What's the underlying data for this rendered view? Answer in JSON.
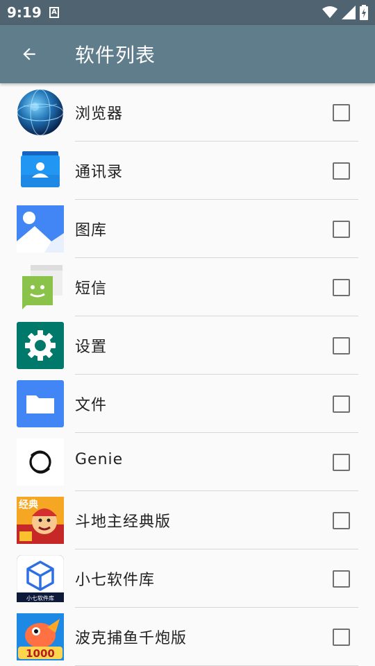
{
  "status_bar": {
    "time": "9:19",
    "notification_icon": "a-notification-icon",
    "icons": [
      "wifi-icon",
      "signal-icon",
      "battery-charging-icon"
    ]
  },
  "app_bar": {
    "title": "软件列表",
    "back_icon": "arrow-back-icon",
    "background": "#607d8b"
  },
  "apps": [
    {
      "label": "浏览器",
      "icon": "globe-icon",
      "checked": false
    },
    {
      "label": "通讯录",
      "icon": "contacts-icon",
      "checked": false
    },
    {
      "label": "图库",
      "icon": "gallery-icon",
      "checked": false
    },
    {
      "label": "短信",
      "icon": "messaging-icon",
      "checked": false
    },
    {
      "label": "设置",
      "icon": "settings-gear-icon",
      "checked": false
    },
    {
      "label": "文件",
      "icon": "folder-icon",
      "checked": false
    },
    {
      "label": "Genie",
      "icon": "genie-logo-icon",
      "checked": false
    },
    {
      "label": "斗地主经典版",
      "icon": "doudizhu-icon",
      "icon_text": "经典",
      "checked": false
    },
    {
      "label": "小七软件库",
      "icon": "cube-icon",
      "icon_text": "小七软件库",
      "checked": false
    },
    {
      "label": "波克捕鱼千炮版",
      "icon": "fishing-game-icon",
      "icon_text": "1000",
      "checked": false
    }
  ]
}
